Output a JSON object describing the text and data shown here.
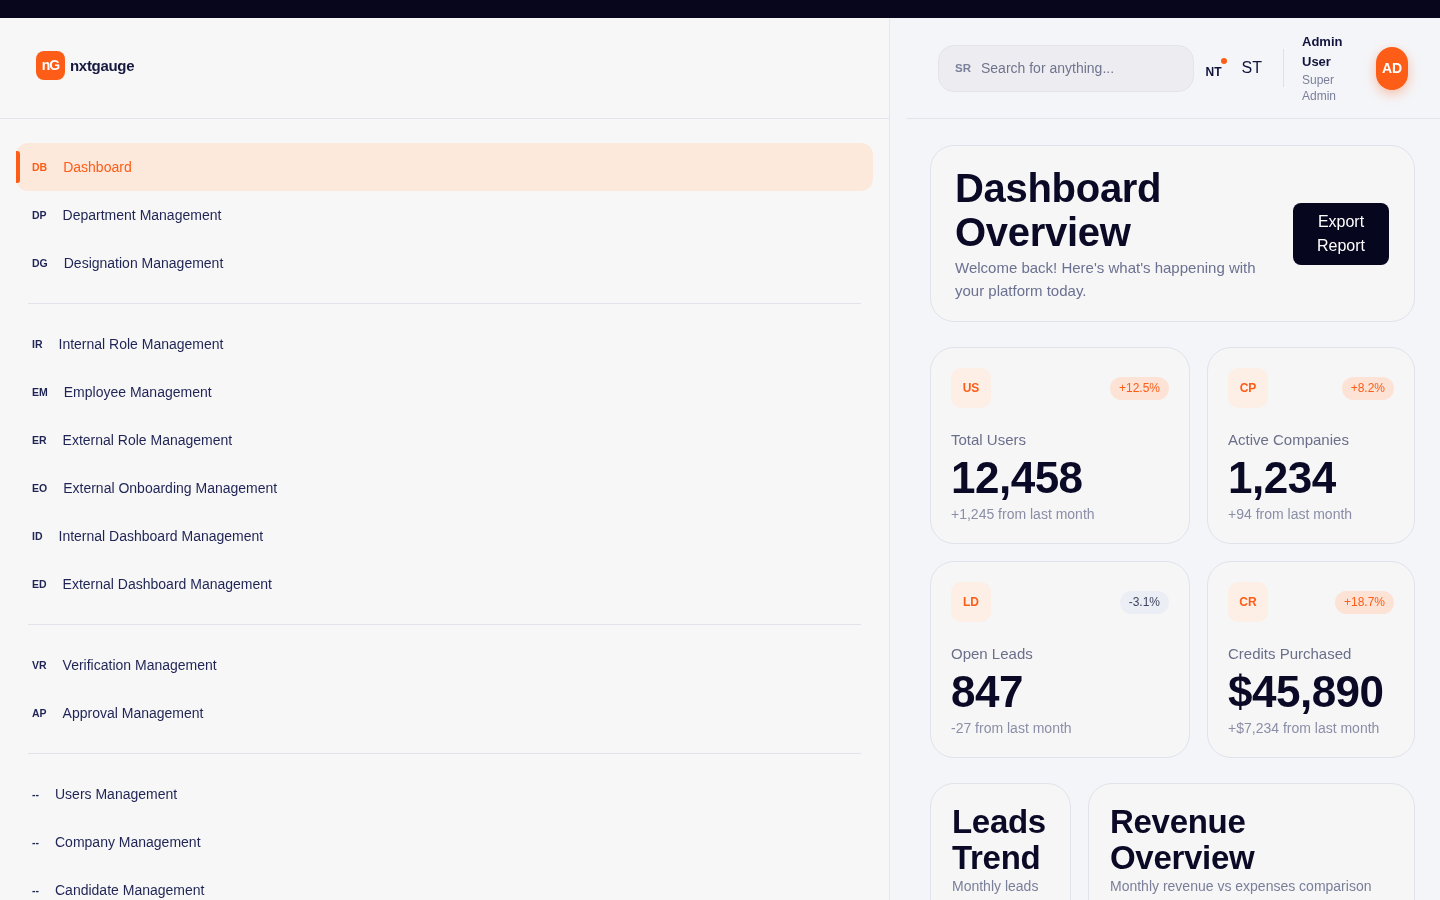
{
  "sidebar": {
    "logo": {
      "mark": "nG",
      "name": "nxtgauge"
    },
    "groups": [
      {
        "items": [
          {
            "code": "DB",
            "label": "Dashboard",
            "selected": true
          },
          {
            "code": "DP",
            "label": "Department Management",
            "selected": false
          },
          {
            "code": "DG",
            "label": "Designation Management",
            "selected": false
          }
        ]
      },
      {
        "items": [
          {
            "code": "IR",
            "label": "Internal Role Management",
            "selected": false
          },
          {
            "code": "EM",
            "label": "Employee Management",
            "selected": false
          },
          {
            "code": "ER",
            "label": "External Role Management",
            "selected": false
          },
          {
            "code": "EO",
            "label": "External Onboarding Management",
            "selected": false
          },
          {
            "code": "ID",
            "label": "Internal Dashboard Management",
            "selected": false
          },
          {
            "code": "ED",
            "label": "External Dashboard Management",
            "selected": false
          }
        ]
      },
      {
        "items": [
          {
            "code": "VR",
            "label": "Verification Management",
            "selected": false
          },
          {
            "code": "AP",
            "label": "Approval Management",
            "selected": false
          }
        ]
      },
      {
        "items": [
          {
            "code": "--",
            "label": "Users Management",
            "selected": false
          },
          {
            "code": "--",
            "label": "Company Management",
            "selected": false
          },
          {
            "code": "--",
            "label": "Candidate Management",
            "selected": false
          }
        ]
      }
    ]
  },
  "header": {
    "search": {
      "code": "SR",
      "placeholder": "Search for anything..."
    },
    "notifications": {
      "label": "NT",
      "unread": true
    },
    "settings": {
      "label": "ST"
    },
    "user": {
      "name": "Admin User",
      "role": "Super Admin",
      "initials": "AD"
    }
  },
  "overview": {
    "title": "Dashboard Overview",
    "subtitle": "Welcome back! Here's what's happening with your platform today.",
    "button": "Export Report"
  },
  "stats": [
    {
      "code": "US",
      "change": "+12.5%",
      "negative": false,
      "label": "Total Users",
      "value": "12,458",
      "note": "+1,245 from last month"
    },
    {
      "code": "CP",
      "change": "+8.2%",
      "negative": false,
      "label": "Active Companies",
      "value": "1,234",
      "note": "+94 from last month"
    },
    {
      "code": "LD",
      "change": "-3.1%",
      "negative": true,
      "label": "Open Leads",
      "value": "847",
      "note": "-27 from last month"
    },
    {
      "code": "CR",
      "change": "+18.7%",
      "negative": false,
      "label": "Credits Purchased",
      "value": "$45,890",
      "note": "+$7,234 from last month"
    }
  ],
  "charts": [
    {
      "title": "Leads Trend",
      "subtitle": "Monthly leads"
    },
    {
      "title": "Revenue Overview",
      "subtitle": "Monthly revenue vs expenses comparison"
    }
  ]
}
